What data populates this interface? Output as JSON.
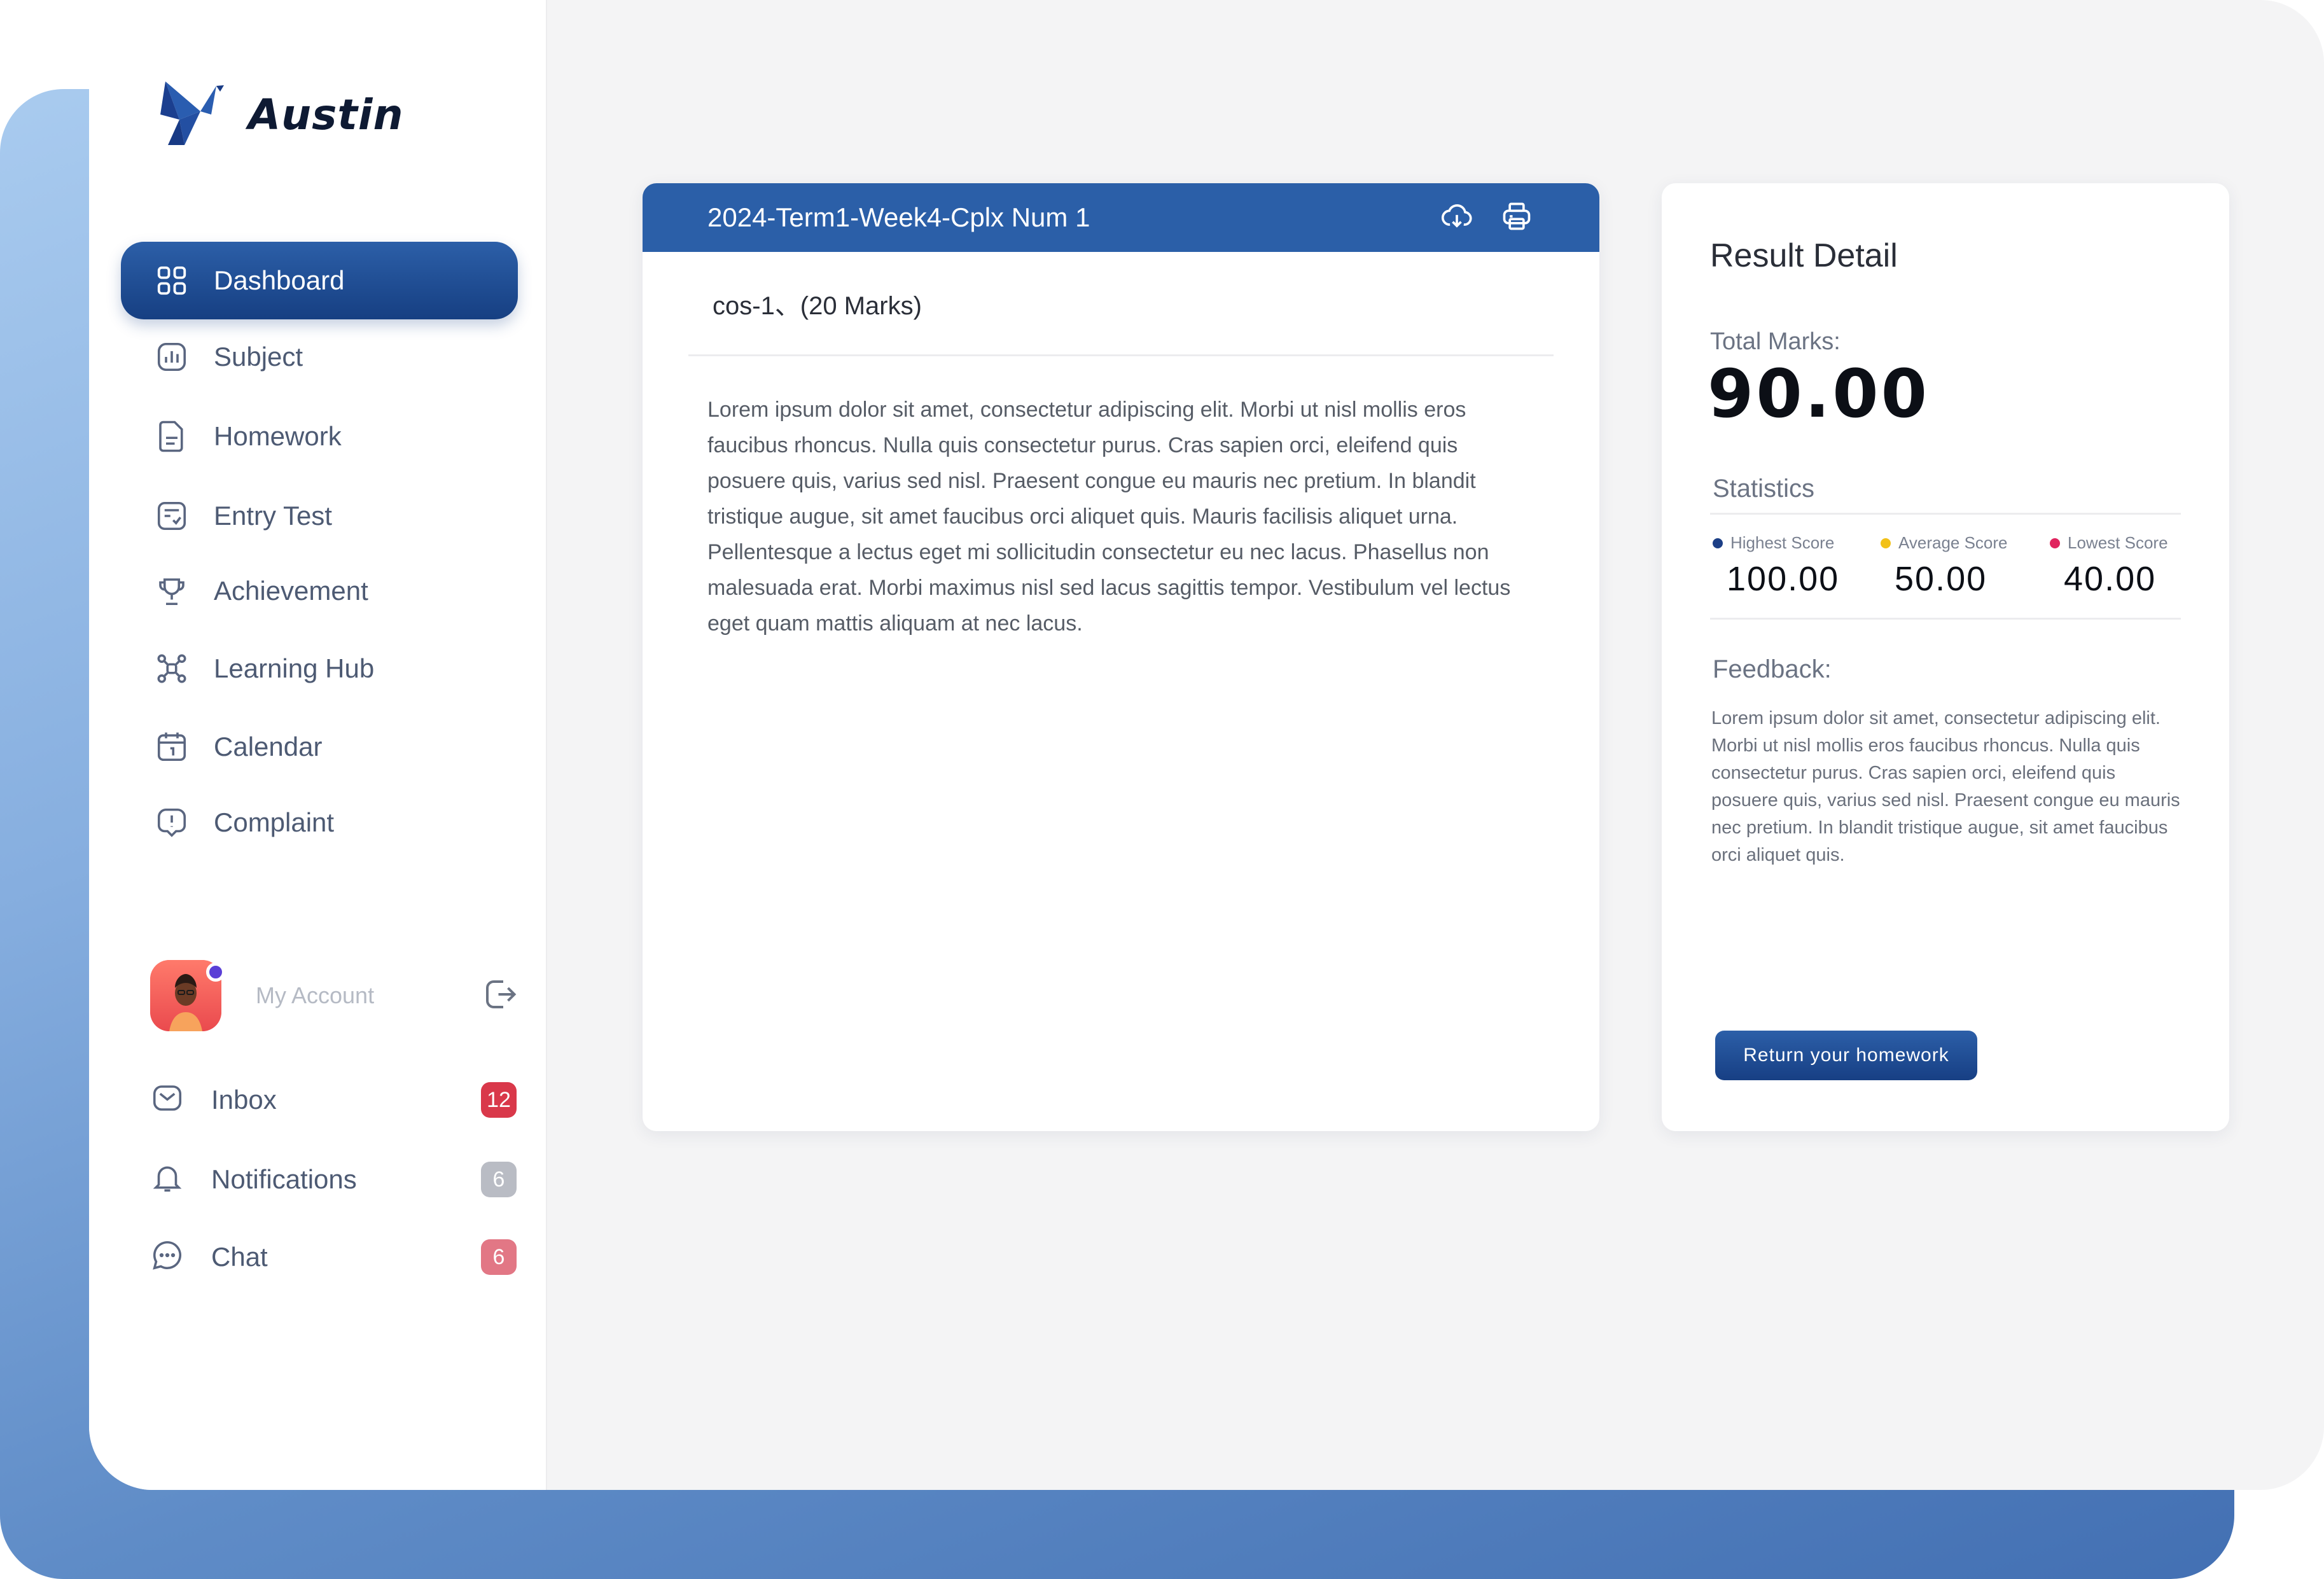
{
  "brand": {
    "name": "Austin"
  },
  "sidebar": {
    "items": [
      {
        "label": "Dashboard",
        "icon": "dashboard-icon",
        "active": true
      },
      {
        "label": "Subject",
        "icon": "chart-icon"
      },
      {
        "label": "Homework",
        "icon": "document-icon"
      },
      {
        "label": "Entry Test",
        "icon": "test-icon"
      },
      {
        "label": "Achievement",
        "icon": "trophy-icon"
      },
      {
        "label": "Learning Hub",
        "icon": "network-icon"
      },
      {
        "label": "Calendar",
        "icon": "calendar-icon"
      },
      {
        "label": "Complaint",
        "icon": "complaint-icon"
      }
    ],
    "account": {
      "label": "My Account"
    },
    "messages": [
      {
        "label": "Inbox",
        "count": "12",
        "badge_color": "#d9384a",
        "icon": "mail-icon"
      },
      {
        "label": "Notifications",
        "count": "6",
        "badge_color": "#b9bcc4",
        "icon": "bell-icon"
      },
      {
        "label": "Chat",
        "count": "6",
        "badge_color": "#e27785",
        "icon": "chat-icon"
      }
    ]
  },
  "homework": {
    "title": "2024-Term1-Week4-Cplx Num 1",
    "question": "cos-1、(20 Marks)",
    "body": "Lorem ipsum dolor sit amet, consectetur adipiscing elit. Morbi ut nisl mollis eros faucibus rhoncus. Nulla quis consectetur purus. Cras sapien orci, eleifend quis posuere quis, varius sed nisl. Praesent congue eu mauris nec pretium. In blandit tristique augue, sit amet faucibus orci aliquet quis. Mauris facilisis aliquet urna. Pellentesque a lectus eget mi sollicitudin consectetur eu nec lacus. Phasellus non malesuada erat. Morbi maximus nisl sed lacus sagittis tempor. Vestibulum vel lectus eget quam mattis aliquam at nec lacus."
  },
  "result": {
    "title": "Result Detail",
    "total_label": "Total Marks:",
    "total_value": "90.00",
    "statistics_label": "Statistics",
    "stats": [
      {
        "label": "Highest Score",
        "value": "100.00",
        "color": "#1c3f86"
      },
      {
        "label": "Average Score",
        "value": "50.00",
        "color": "#f2c118"
      },
      {
        "label": "Lowest Score",
        "value": "40.00",
        "color": "#e0245e"
      }
    ],
    "feedback_label": "Feedback:",
    "feedback_text": "Lorem ipsum dolor sit amet, consectetur adipiscing elit. Morbi ut nisl mollis eros faucibus rhoncus. Nulla quis consectetur purus. Cras sapien orci, eleifend quis posuere quis, varius sed nisl. Praesent congue eu mauris nec pretium. In blandit tristique augue, sit amet faucibus orci aliquet quis.",
    "return_button": "Return your homework"
  },
  "colors": {
    "primary": "#2b5fa8",
    "primary_dark": "#163f82"
  }
}
